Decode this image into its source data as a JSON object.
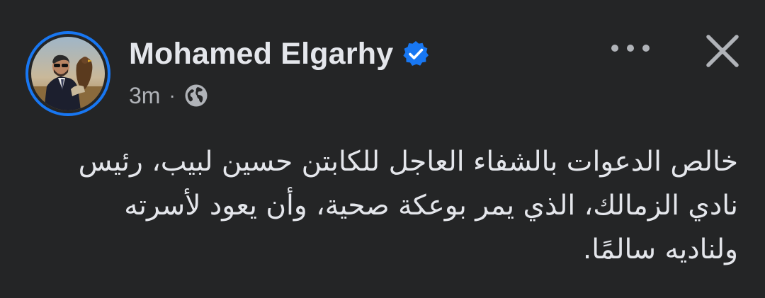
{
  "post": {
    "author": {
      "name": "Mohamed Elgarhy",
      "verified": true,
      "badge_color": "#1877f2"
    },
    "time": "3m",
    "separator": "·",
    "audience_icon": "globe-icon",
    "actions": {
      "more_icon": "more-options-icon",
      "close_icon": "close-icon"
    },
    "text_lines": [
      "خالص الدعوات بالشفاء العاجل للكابتن حسين لبيب، رئيس",
      "نادي الزمالك، الذي يمر بوعكة صحية، وأن يعود لأسرته",
      "ولناديه سالمًا."
    ]
  },
  "colors": {
    "background": "#242526",
    "primary_text": "#e4e6eb",
    "secondary_text": "#b0b3b8",
    "accent": "#1877f2"
  }
}
